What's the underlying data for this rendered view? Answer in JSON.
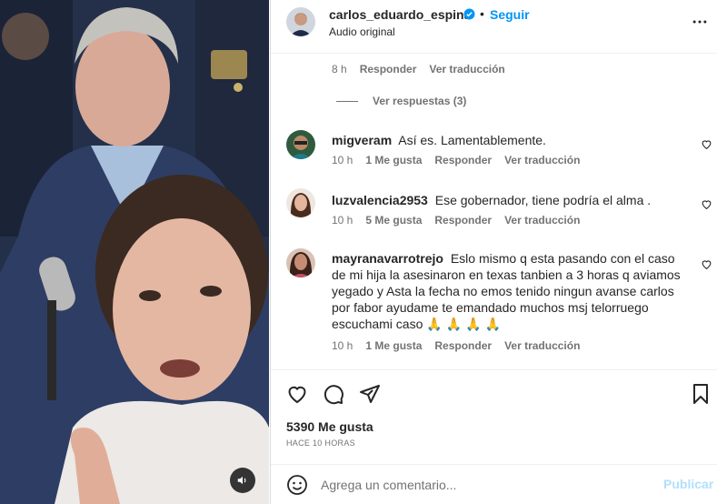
{
  "post": {
    "author": "carlos_eduardo_espina",
    "follow_label": "Seguir",
    "dot": "•",
    "audio": "Audio original",
    "more_icon": "more-horizontal-icon"
  },
  "previous_comment_meta": {
    "time": "8 h",
    "reply": "Responder",
    "translate": "Ver traducción"
  },
  "replies_label": "Ver respuestas (3)",
  "comments": [
    {
      "user": "migveram",
      "text": "Así es. Lamentablemente.",
      "time": "10 h",
      "likes": "1 Me gusta",
      "reply": "Responder",
      "translate": "Ver traducción"
    },
    {
      "user": "luzvalencia2953",
      "text": "Ese gobernador, tiene podría el alma .",
      "time": "10 h",
      "likes": "5 Me gusta",
      "reply": "Responder",
      "translate": "Ver traducción"
    },
    {
      "user": "mayranavarrotrejo",
      "text": "Eslo mismo q esta pasando con el caso de mi hija la asesinaron en texas tanbien a 3 horas q aviamos yegado y Asta la fecha no emos tenido ningun avanse carlos por fabor ayudame te emandado muchos msj telorruego escuchami caso",
      "emojis": "🙏🙏🙏🙏",
      "time": "10 h",
      "likes": "1 Me gusta",
      "reply": "Responder",
      "translate": "Ver traducción"
    }
  ],
  "actions": {
    "like_icon": "heart-icon",
    "comment_icon": "comment-icon",
    "share_icon": "share-icon",
    "save_icon": "bookmark-icon"
  },
  "likes_count": "5390 Me gusta",
  "posted_time": "HACE 10 HORAS",
  "add_comment": {
    "placeholder": "Agrega un comentario...",
    "publish_label": "Publicar",
    "emoji_icon": "emoji-icon"
  },
  "media": {
    "mute_icon": "speaker-icon"
  },
  "colors": {
    "link_blue": "#0095f6",
    "publish_disabled": "#b2dffc",
    "secondary_text": "#737373",
    "primary_text": "#262626"
  }
}
